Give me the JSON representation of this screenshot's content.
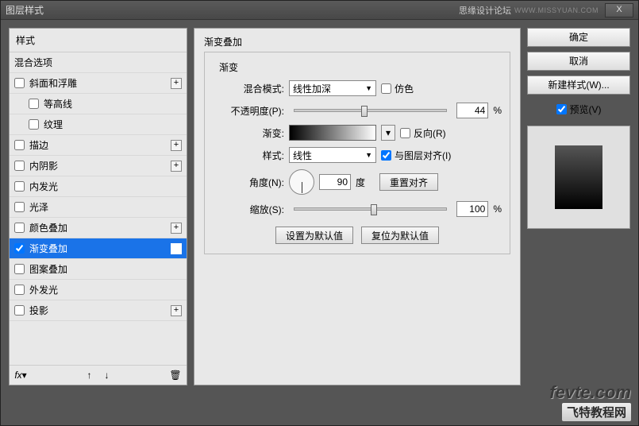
{
  "window": {
    "title": "图层样式",
    "forum": "思缘设计论坛",
    "url": "WWW.MISSYUAN.COM",
    "close": "X"
  },
  "styles": {
    "header": "样式",
    "blending_options": "混合选项",
    "items": [
      {
        "label": "斜面和浮雕",
        "checked": false,
        "expand": true,
        "indent": false
      },
      {
        "label": "等高线",
        "checked": false,
        "expand": false,
        "indent": true
      },
      {
        "label": "纹理",
        "checked": false,
        "expand": false,
        "indent": true
      },
      {
        "label": "描边",
        "checked": false,
        "expand": true,
        "indent": false
      },
      {
        "label": "内阴影",
        "checked": false,
        "expand": true,
        "indent": false
      },
      {
        "label": "内发光",
        "checked": false,
        "expand": false,
        "indent": false
      },
      {
        "label": "光泽",
        "checked": false,
        "expand": false,
        "indent": false
      },
      {
        "label": "颜色叠加",
        "checked": false,
        "expand": true,
        "indent": false
      },
      {
        "label": "渐变叠加",
        "checked": true,
        "expand": true,
        "indent": false,
        "selected": true
      },
      {
        "label": "图案叠加",
        "checked": false,
        "expand": false,
        "indent": false
      },
      {
        "label": "外发光",
        "checked": false,
        "expand": false,
        "indent": false
      },
      {
        "label": "投影",
        "checked": false,
        "expand": true,
        "indent": false
      }
    ],
    "expand_icon": "+"
  },
  "settings": {
    "section_title": "渐变叠加",
    "group_title": "渐变",
    "blend_mode_label": "混合模式:",
    "blend_mode_value": "线性加深",
    "dither_label": "仿色",
    "opacity_label": "不透明度(P):",
    "opacity_value": "44",
    "percent": "%",
    "gradient_label": "渐变:",
    "reverse_label": "反向(R)",
    "style_label": "样式:",
    "style_value": "线性",
    "align_label": "与图层对齐(I)",
    "angle_label": "角度(N):",
    "angle_value": "90",
    "degree": "度",
    "reset_align": "重置对齐",
    "scale_label": "缩放(S):",
    "scale_value": "100",
    "set_default": "设置为默认值",
    "reset_default": "复位为默认值"
  },
  "right": {
    "ok": "确定",
    "cancel": "取消",
    "new_style": "新建样式(W)...",
    "preview": "预览(V)"
  },
  "watermark": {
    "line1": "fevte.com",
    "line2": "飞特教程网"
  }
}
